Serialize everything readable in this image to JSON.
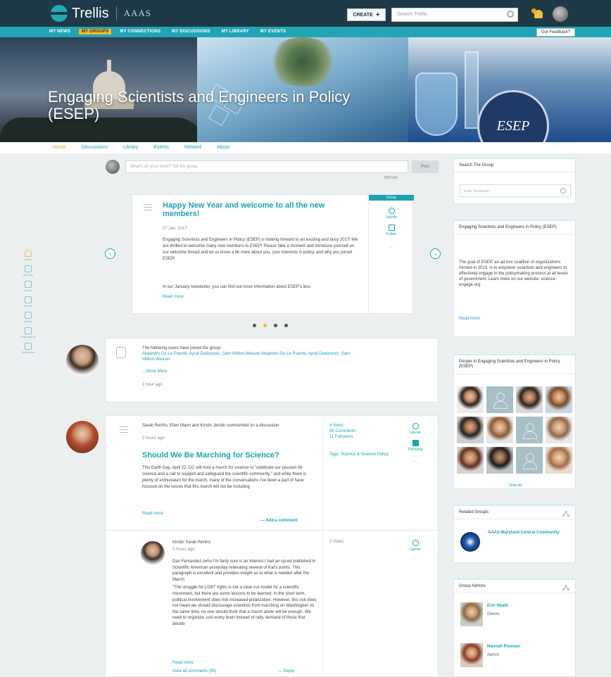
{
  "topbar": {
    "brand": "Trellis",
    "partner": "AAAS",
    "create_label": "CREATE",
    "search_placeholder": "Search Trellis"
  },
  "nav": {
    "items": [
      "MY NEWS",
      "MY GROUPS",
      "MY CONNECTIONS",
      "MY DISCUSSIONS",
      "MY LIBRARY",
      "MY EVENTS"
    ],
    "active_index": 1,
    "feedback_label": "Got Feedback?"
  },
  "banner": {
    "title_line1": "Engaging Scientists and Engineers in Policy",
    "title_line2": "(ESEP)",
    "badge": "ESEP"
  },
  "group_tabs": [
    "Home",
    "Discussions",
    "Library",
    "Events",
    "Related",
    "About"
  ],
  "left_rail": [
    "Award",
    "Discuss",
    "Share",
    "Events",
    "Library",
    "Notifications",
    "Dashboard"
  ],
  "composer": {
    "placeholder": "What's on your mind? Tell the group",
    "post_label": "Post",
    "char_count": "2000 left"
  },
  "carousel": {
    "tag": "Group",
    "title": "Happy New Year and welcome to all the new members!",
    "date": "07 Jan, 2017",
    "body": "Engaging Scientists and Engineers in Policy (ESEP) is looking forward to an exciting and busy 2017! We are thrilled to welcome many new members to ESEP! Please take a moment and introduce yourself on our welcome thread and let us know a bit more about you, your interests in policy, and why you joined ESEP!",
    "body2": "In our January newsletter, you can find out more information about ESEP's less",
    "readmore": "Read more",
    "actions": [
      "Upvote",
      "Follow"
    ]
  },
  "join_item": {
    "line": "The following users have joined the group:",
    "names": "Alejandro De La Puente, Ayrat Dedanovic, Sam Million-Weaver Alejandro De La Puente, Ayrat Dedanovic, Sam Million-Weaver",
    "showmore": "...Show More",
    "ago": "1 hour ago"
  },
  "discussion": {
    "who": "Sarah Renfro, Ellen Mann and Kirstin Jerstin commented on a discussion",
    "ago": "2 hours ago",
    "title": "Should We Be Marching for Science?",
    "body": "This Earth Day, April 22, DC will host a march for science to \"celebrate our passion for science and a call to support and safeguard the scientific community,\" and while there is plenty of enthusiasm for the march, many of the conversations I've been a part of have focused on the voices that this march will not be including",
    "readmore": "Read more",
    "add_comment": "Add a comment",
    "stats": [
      "4 Votes",
      "95 Comments",
      "11 Followers"
    ],
    "tags": "Tags: Science & Science Policy",
    "actions": [
      "Upvote",
      "Following"
    ]
  },
  "reply": {
    "name": "Kirstin Sarah Renfro",
    "ago": "2 hours ago",
    "p1": "Dan Fernandez (who I'm fairly sure is an Interest I had an op-ed published in Scientific American yesterday reiterating several of Kat's points. This paragraph is excellent and provides insight as to what is needed after the March:",
    "p2": "\"The struggle for LGBT rights is not a clear-cut model for a scientific movement, but there are some lessons to be learned. In the short term, political involvement does risk increased polarization. However, this risk does not mean we should discourage scientists from marching on Washington. At the same time, no one should think that a march alone will be enough. We need to organize, use every lever instead of rally, demand of those that decide",
    "readmore": "Read more",
    "view_all": "View all comments (95)",
    "reply_label": "Reply",
    "votes": "0 Votes",
    "action": "Upvote"
  },
  "sidebar": {
    "search_title": "Search The Group",
    "search_placeholder": "Enter Keywords",
    "about_title": "Engaging Scientists and Engineers in Policy (ESEP)",
    "about_desc": "The goal of ESEP, an ad hoc coalition of organizations formed in 2013, is to empower scientists and engineers to effectively engage in the policymaking process at all levels of government. Learn more on our website: science-engage.org",
    "about_more": "Read more",
    "people_title": "People in Engaging Scientists and Engineers in Policy (ESEP)",
    "people_showall": "Show All",
    "related_title": "Related Groups",
    "related_name": "AAAS Maryland Central Community",
    "admins_title": "Group Admins",
    "admins": [
      {
        "name": "Erin Heath",
        "role": "Owner"
      },
      {
        "name": "Hannah Poulsen",
        "role": "Admin"
      }
    ]
  },
  "colors": {
    "brand_dark": "#1e3a47",
    "accent_teal": "#1aa3b3",
    "accent_yellow": "#f2b92a"
  }
}
